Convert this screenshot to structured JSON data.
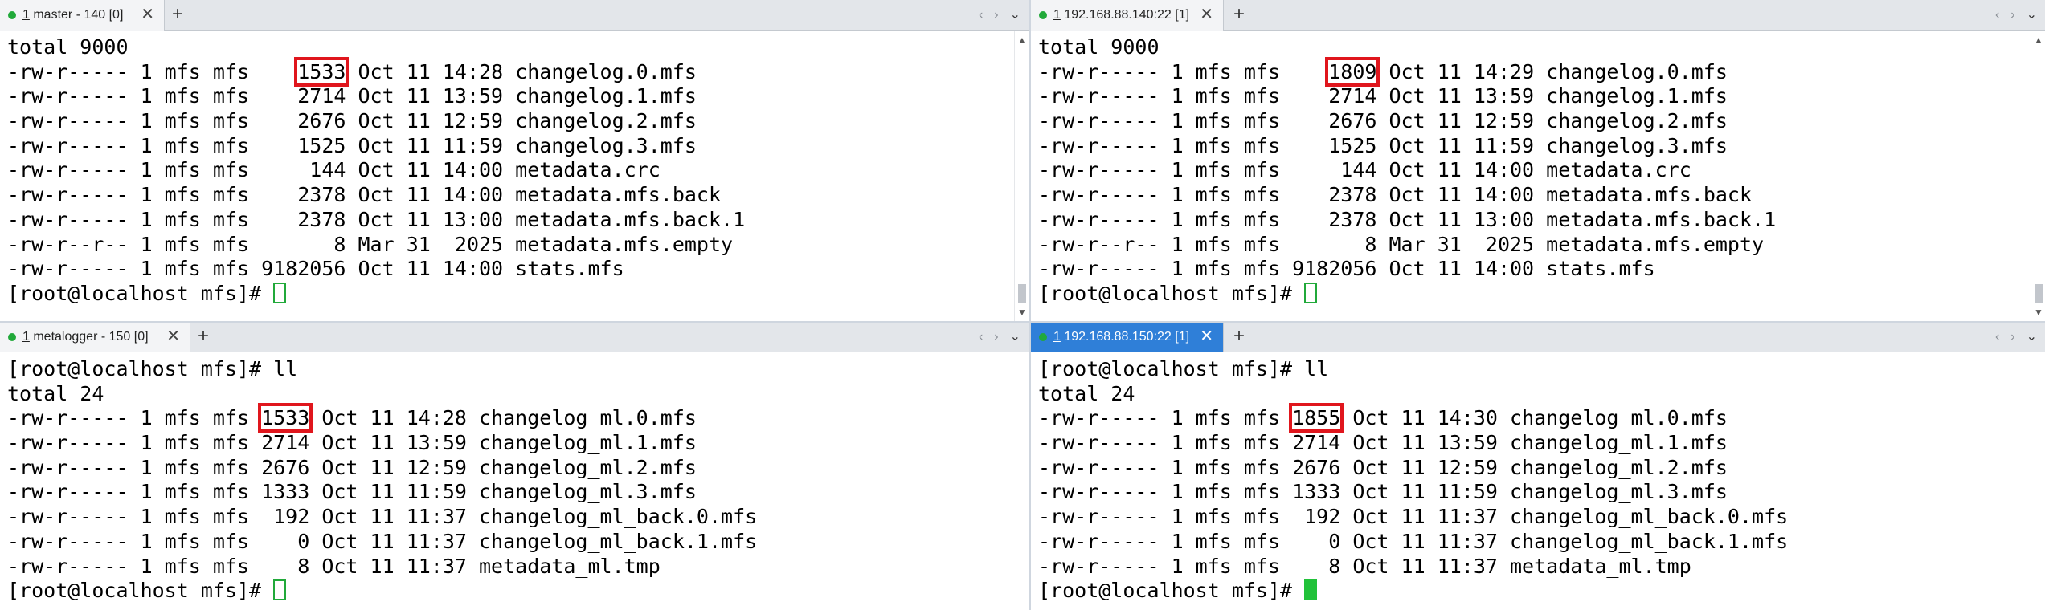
{
  "panes": {
    "tl": {
      "tab": {
        "dot_color": "#21a93a",
        "num": "1",
        "title": " master - 140 [0]",
        "close": "✕",
        "new_tab": "+"
      },
      "lines": [
        "total 9000",
        "-rw-r----- 1 mfs mfs    1533 Oct 11 14:28 changelog.0.mfs",
        "-rw-r----- 1 mfs mfs    2714 Oct 11 13:59 changelog.1.mfs",
        "-rw-r----- 1 mfs mfs    2676 Oct 11 12:59 changelog.2.mfs",
        "-rw-r----- 1 mfs mfs    1525 Oct 11 11:59 changelog.3.mfs",
        "-rw-r----- 1 mfs mfs     144 Oct 11 14:00 metadata.crc",
        "-rw-r----- 1 mfs mfs    2378 Oct 11 14:00 metadata.mfs.back",
        "-rw-r----- 1 mfs mfs    2378 Oct 11 13:00 metadata.mfs.back.1",
        "-rw-r--r-- 1 mfs mfs       8 Mar 31  2025 metadata.mfs.empty",
        "-rw-r----- 1 mfs mfs 9182056 Oct 11 14:00 stats.mfs",
        "[root@localhost mfs]# "
      ],
      "highlight": {
        "pre": "-rw-r----- 1 mfs mfs    ",
        "val": "1533",
        "post": " Oct 11 14:28 changelog.0.mfs"
      }
    },
    "tr": {
      "tab": {
        "dot_color": "#21a93a",
        "num": "1",
        "title": " 192.168.88.140:22 [1]",
        "close": "✕",
        "new_tab": "+"
      },
      "lines": [
        "total 9000",
        "-rw-r----- 1 mfs mfs    1809 Oct 11 14:29 changelog.0.mfs",
        "-rw-r----- 1 mfs mfs    2714 Oct 11 13:59 changelog.1.mfs",
        "-rw-r----- 1 mfs mfs    2676 Oct 11 12:59 changelog.2.mfs",
        "-rw-r----- 1 mfs mfs    1525 Oct 11 11:59 changelog.3.mfs",
        "-rw-r----- 1 mfs mfs     144 Oct 11 14:00 metadata.crc",
        "-rw-r----- 1 mfs mfs    2378 Oct 11 14:00 metadata.mfs.back",
        "-rw-r----- 1 mfs mfs    2378 Oct 11 13:00 metadata.mfs.back.1",
        "-rw-r--r-- 1 mfs mfs       8 Mar 31  2025 metadata.mfs.empty",
        "-rw-r----- 1 mfs mfs 9182056 Oct 11 14:00 stats.mfs",
        "[root@localhost mfs]# "
      ],
      "highlight": {
        "pre": "-rw-r----- 1 mfs mfs    ",
        "val": "1809",
        "post": " Oct 11 14:29 changelog.0.mfs"
      }
    },
    "bl": {
      "tab": {
        "dot_color": "#21a93a",
        "num": "1",
        "title": " metalogger - 150 [0]",
        "close": "✕",
        "new_tab": "+"
      },
      "lines": [
        "[root@localhost mfs]# ll",
        "total 24",
        "-rw-r----- 1 mfs mfs 1533 Oct 11 14:28 changelog_ml.0.mfs",
        "-rw-r----- 1 mfs mfs 2714 Oct 11 13:59 changelog_ml.1.mfs",
        "-rw-r----- 1 mfs mfs 2676 Oct 11 12:59 changelog_ml.2.mfs",
        "-rw-r----- 1 mfs mfs 1333 Oct 11 11:59 changelog_ml.3.mfs",
        "-rw-r----- 1 mfs mfs  192 Oct 11 11:37 changelog_ml_back.0.mfs",
        "-rw-r----- 1 mfs mfs    0 Oct 11 11:37 changelog_ml_back.1.mfs",
        "-rw-r----- 1 mfs mfs    8 Oct 11 11:37 metadata_ml.tmp",
        "[root@localhost mfs]# "
      ],
      "highlight": {
        "pre": "-rw-r----- 1 mfs mfs ",
        "val": "1533",
        "post": " Oct 11 14:28 changelog_ml.0.mfs"
      }
    },
    "br": {
      "tab": {
        "dot_color": "#21a93a",
        "num": "1",
        "title": " 192.168.88.150:22 [1]",
        "close": "✕",
        "new_tab": "+"
      },
      "lines": [
        "[root@localhost mfs]# ll",
        "total 24",
        "-rw-r----- 1 mfs mfs 1855 Oct 11 14:30 changelog_ml.0.mfs",
        "-rw-r----- 1 mfs mfs 2714 Oct 11 13:59 changelog_ml.1.mfs",
        "-rw-r----- 1 mfs mfs 2676 Oct 11 12:59 changelog_ml.2.mfs",
        "-rw-r----- 1 mfs mfs 1333 Oct 11 11:59 changelog_ml.3.mfs",
        "-rw-r----- 1 mfs mfs  192 Oct 11 11:37 changelog_ml_back.0.mfs",
        "-rw-r----- 1 mfs mfs    0 Oct 11 11:37 changelog_ml_back.1.mfs",
        "-rw-r----- 1 mfs mfs    8 Oct 11 11:37 metadata_ml.tmp",
        "[root@localhost mfs]# "
      ],
      "highlight": {
        "pre": "-rw-r----- 1 mfs mfs ",
        "val": "1855",
        "post": " Oct 11 14:30 changelog_ml.0.mfs"
      }
    }
  },
  "colors": {
    "highlight_box": "#e0161d",
    "active_tab": "#2f7fd8",
    "status_dot": "#21a93a",
    "cursor": "#21c23a"
  }
}
